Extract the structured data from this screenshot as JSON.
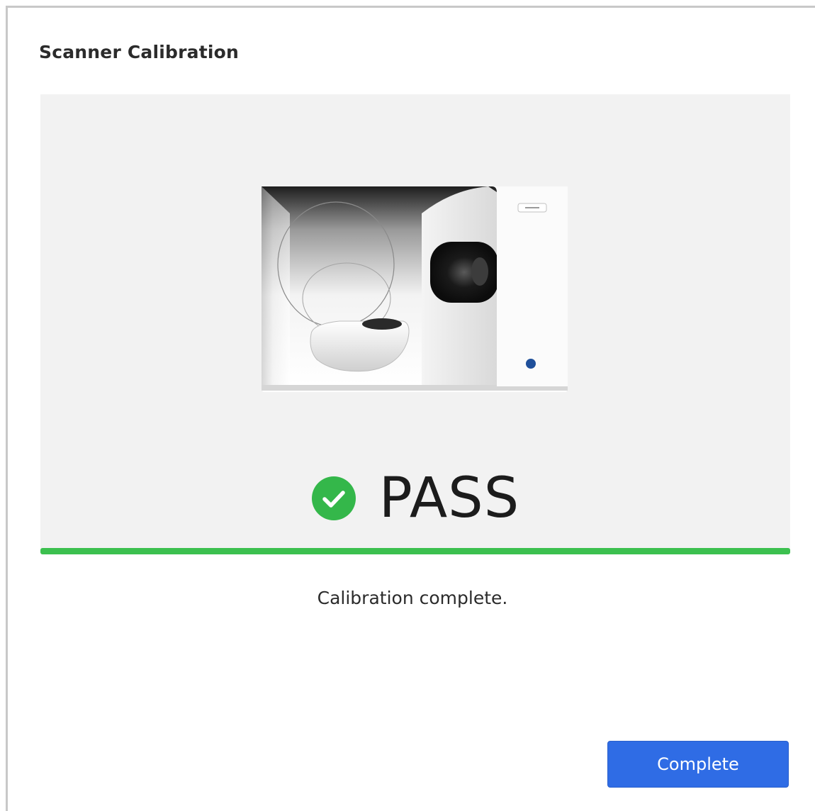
{
  "dialog": {
    "title": "Scanner Calibration",
    "result": "PASS",
    "result_icon": "check-circle-icon",
    "result_color": "#34b74a",
    "progress": 1.0,
    "progress_color": "#3cc04f",
    "message": "Calibration complete.",
    "complete_button_label": "Complete",
    "button_color": "#2f6ce5"
  }
}
